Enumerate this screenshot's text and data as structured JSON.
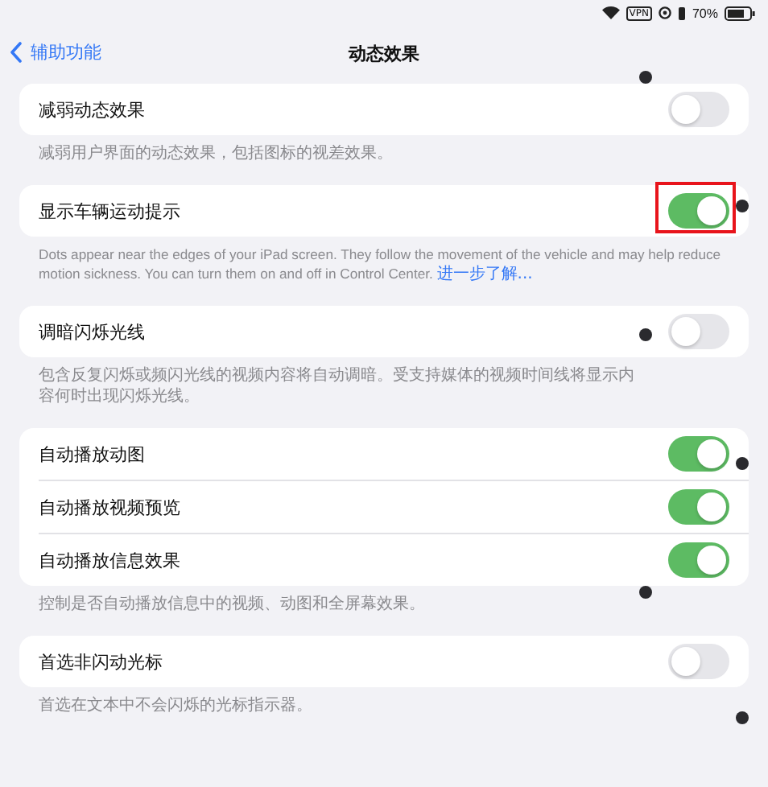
{
  "status_bar": {
    "vpn": "VPN",
    "battery": "70%"
  },
  "nav": {
    "back": "辅助功能",
    "title": "动态效果"
  },
  "groups": [
    {
      "rows": [
        {
          "label": "减弱动态效果",
          "on": false,
          "highlighted": false
        }
      ],
      "footer": "减弱用户界面的动态效果，包括图标的视差效果。"
    },
    {
      "rows": [
        {
          "label": "显示车辆运动提示",
          "on": true,
          "highlighted": true
        }
      ],
      "footer": "Dots appear near the edges of your iPad screen. They follow the movement of the vehicle and may help reduce motion sickness. You can turn them on and off in Control Center.",
      "footer_link": "进一步了解..."
    },
    {
      "rows": [
        {
          "label": "调暗闪烁光线",
          "on": false,
          "highlighted": false
        }
      ],
      "footer": "包含反复闪烁或频闪光线的视频内容将自动调暗。受支持媒体的视频时间线将显示内容何时出现闪烁光线。"
    },
    {
      "rows": [
        {
          "label": "自动播放动图",
          "on": true,
          "highlighted": false
        },
        {
          "label": "自动播放视频预览",
          "on": true,
          "highlighted": false
        },
        {
          "label": "自动播放信息效果",
          "on": true,
          "highlighted": false
        }
      ],
      "footer": "控制是否自动播放信息中的视频、动图和全屏幕效果。"
    },
    {
      "rows": [
        {
          "label": "首选非闪动光标",
          "on": false,
          "highlighted": false
        }
      ],
      "footer": "首选在文本中不会闪烁的光标指示器。"
    }
  ]
}
